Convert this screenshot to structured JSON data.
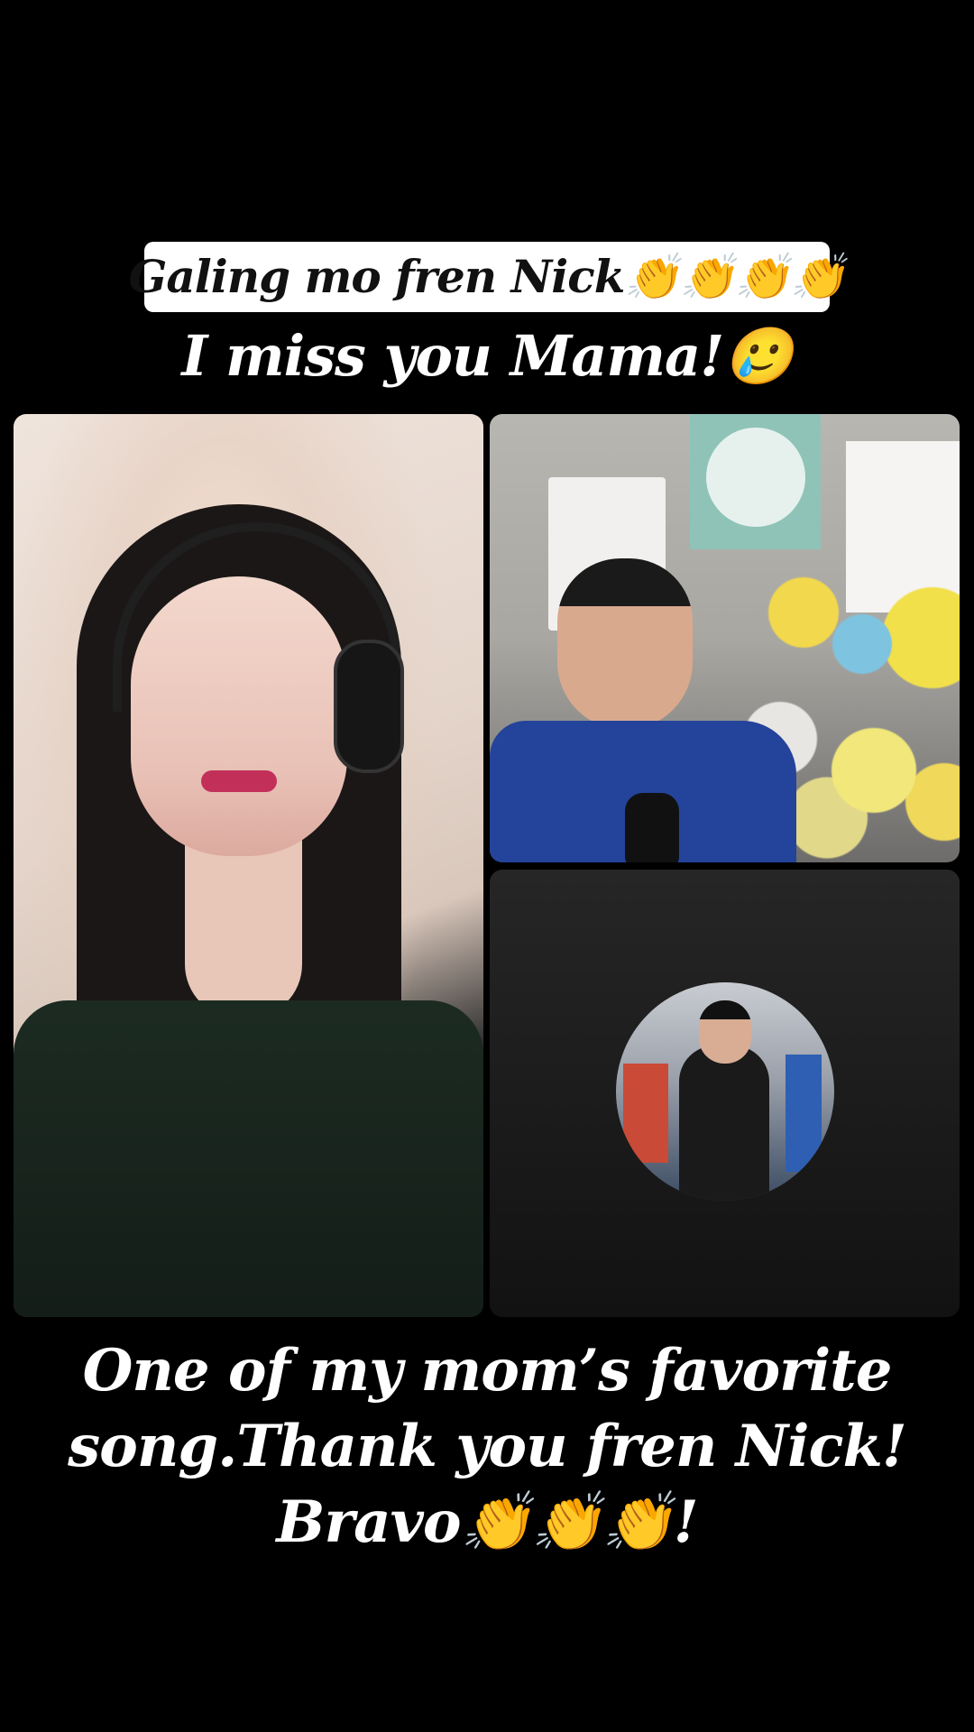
{
  "captions": {
    "top_pill": "Galing mo fren Nick👏👏👏👏",
    "subtitle": "I miss you Mama!🥲",
    "bottom_lines": [
      "One of my mom’s favorite",
      "song.Thank you fren Nick!",
      "Bravo👏👏👏!"
    ]
  },
  "colors": {
    "background": "#000000",
    "pill_background": "#ffffff",
    "pill_text": "#111111",
    "caption_text": "#ffffff"
  }
}
